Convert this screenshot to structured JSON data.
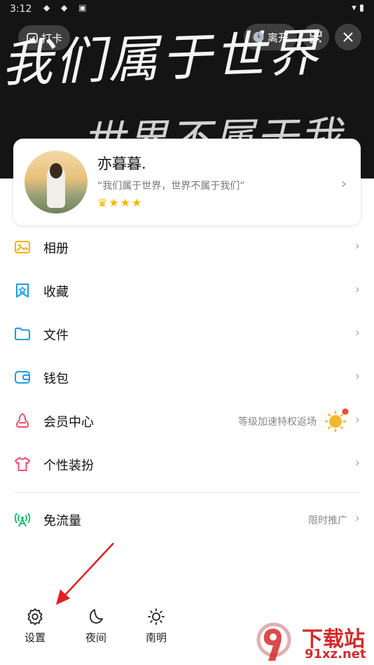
{
  "status_bar": {
    "time": "3:12",
    "signal": "▾ ▮"
  },
  "header": {
    "punch_label": "打卡",
    "leave_label": "离开",
    "handwriting_line1": "我们属于世界",
    "handwriting_line2": "世界不属于我们"
  },
  "profile": {
    "name": "亦暮暮.",
    "signature": "“我们属于世界，世界不属于我们”",
    "level_icons": "♛★★★"
  },
  "menu": [
    {
      "label": "相册",
      "icon": "photo-album-icon"
    },
    {
      "label": "收藏",
      "icon": "favorites-icon"
    },
    {
      "label": "文件",
      "icon": "folder-icon"
    },
    {
      "label": "钱包",
      "icon": "wallet-icon"
    },
    {
      "label": "会员中心",
      "icon": "vip-icon",
      "sub": "等级加速特权返场"
    },
    {
      "label": "个性装扮",
      "icon": "tshirt-icon"
    }
  ],
  "free_traffic": {
    "label": "免流量",
    "sub": "限时推广"
  },
  "bottom": {
    "settings_label": "设置",
    "night_label": "夜间",
    "weather_label": "南明"
  },
  "watermark": {
    "brand": "下载站",
    "domain": "91xz.net"
  },
  "colors": {
    "album": "#f2b400",
    "favorites": "#1a9de8",
    "folder": "#1a9de8",
    "wallet": "#1a9de8",
    "vip": "#f0506e",
    "dress": "#f0506e",
    "free": "#1fbf6a",
    "arrow": "#e02020"
  }
}
